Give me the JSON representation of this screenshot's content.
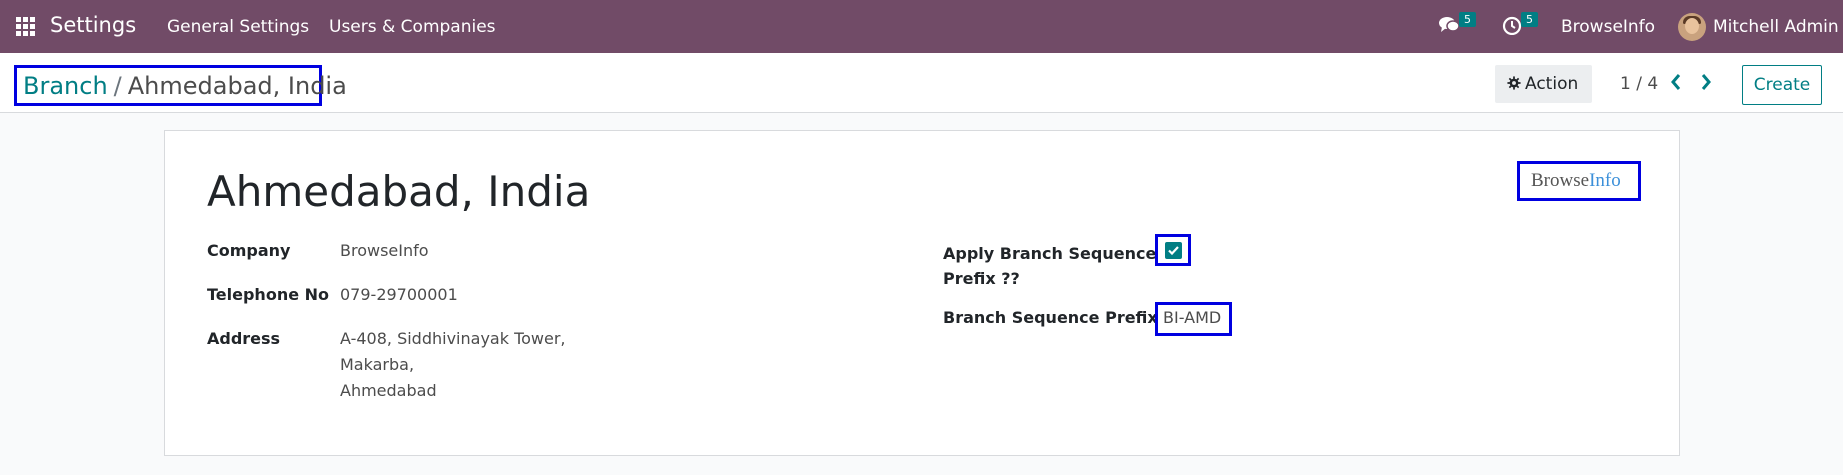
{
  "navbar": {
    "app_title": "Settings",
    "menu": [
      "General Settings",
      "Users & Companies"
    ],
    "messages_badge": "5",
    "activities_badge": "5",
    "company": "BrowseInfo",
    "user": "Mitchell Admin"
  },
  "control_panel": {
    "breadcrumb_parent": "Branch",
    "breadcrumb_separator": "/",
    "breadcrumb_current": "Ahmedabad, India",
    "action_label": "Action",
    "pager": "1 / 4",
    "create_label": "Create"
  },
  "form": {
    "title": "Ahmedabad, India",
    "logo_part1": "Browse",
    "logo_part2": "Info",
    "company_label": "Company",
    "company_value": "BrowseInfo",
    "telephone_label": "Telephone No",
    "telephone_value": "079-29700001",
    "address_label": "Address",
    "address_lines": [
      "A-408, Siddhivinayak Tower,",
      "Makarba,",
      "Ahmedabad"
    ],
    "apply_prefix_label_line1": "Apply Branch Sequence",
    "apply_prefix_label_line2": "Prefix ??",
    "apply_prefix_checked": true,
    "prefix_label": "Branch Sequence Prefix",
    "prefix_value": "BI-AMD"
  },
  "colors": {
    "navbar": "#714b67",
    "accent": "#017e84",
    "highlight_border": "#0000e0"
  },
  "icons": [
    "apps-grid-icon",
    "chat-icon",
    "clock-icon",
    "gear-icon",
    "chevron-left-icon",
    "chevron-right-icon",
    "checkmark-icon"
  ]
}
